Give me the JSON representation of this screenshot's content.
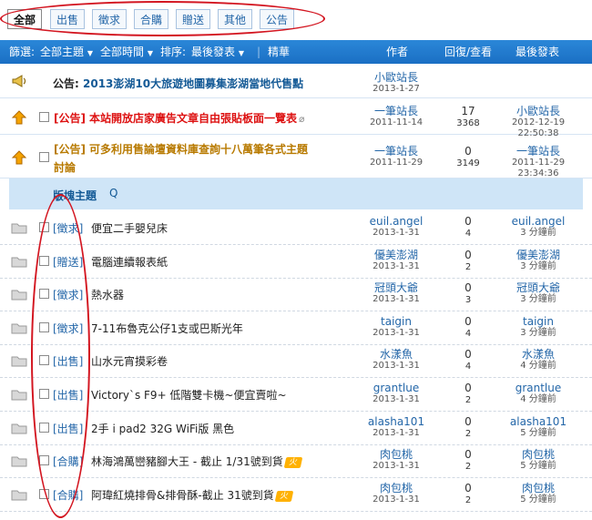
{
  "tabs": [
    "全部",
    "出售",
    "徵求",
    "合購",
    "贈送",
    "其他",
    "公告"
  ],
  "filterbar": {
    "filter_label": "篩選:",
    "all_topics": "全部主題",
    "all_time": "全部時間",
    "sort_label": "排序:",
    "sort_value": "最後發表",
    "divider": "|",
    "featured": "精華",
    "col_author": "作者",
    "col_replies": "回復/查看",
    "col_last": "最後發表"
  },
  "announcement": {
    "prefix": "公告:",
    "title": "2013澎湖10大旅遊地圖募集澎湖當地代售點",
    "author": "小歐站長",
    "date": "2013-1-27"
  },
  "sticky": [
    {
      "tag": "[公告]",
      "title_line1": "本站開放店家廣告文章自由張貼板面一覽表",
      "title_line2": "",
      "author": "一筆站長",
      "date": "2011-11-14",
      "replies": "17",
      "views": "3368",
      "last_author": "小歐站長",
      "last_time": "2012-12-19 22:50:38"
    },
    {
      "tag": "[公告]",
      "title_line1": "可多利用售論壇資料庫查詢十八萬筆各式主題",
      "title_line2": "討論",
      "author": "一筆站長",
      "date": "2011-11-29",
      "replies": "0",
      "views": "3149",
      "last_author": "一筆站長",
      "last_time": "2011-11-29 23:34:36"
    }
  ],
  "section": {
    "label": "版塊主題",
    "refresh_icon": "Q"
  },
  "threads": [
    {
      "tag": "[徵求]",
      "title": "便宜二手嬰兒床",
      "author": "euil.angel",
      "date": "2013-1-31",
      "replies": "0",
      "views": "4",
      "last_author": "euil.angel",
      "last_time": "3 分鐘前",
      "hot": ""
    },
    {
      "tag": "[贈送]",
      "title": "電腦連續報表紙",
      "author": "優美澎湖",
      "date": "2013-1-31",
      "replies": "0",
      "views": "2",
      "last_author": "優美澎湖",
      "last_time": "3 分鐘前",
      "hot": ""
    },
    {
      "tag": "[徵求]",
      "title": "熱水器",
      "author": "冠頭大爺",
      "date": "2013-1-31",
      "replies": "0",
      "views": "3",
      "last_author": "冠頭大爺",
      "last_time": "3 分鐘前",
      "hot": ""
    },
    {
      "tag": "[徵求]",
      "title": "7-11布魯克公仔1支或巴斯光年",
      "author": "taigin",
      "date": "2013-1-31",
      "replies": "0",
      "views": "4",
      "last_author": "taigin",
      "last_time": "3 分鐘前",
      "hot": ""
    },
    {
      "tag": "[出售]",
      "title": "山水元宵摸彩卷",
      "author": "水漾魚",
      "date": "2013-1-31",
      "replies": "0",
      "views": "4",
      "last_author": "水漾魚",
      "last_time": "4 分鐘前",
      "hot": ""
    },
    {
      "tag": "[出售]",
      "title": "Victory`s F9+ 低階雙卡機~便宜賣啦~",
      "author": "grantlue",
      "date": "2013-1-31",
      "replies": "0",
      "views": "2",
      "last_author": "grantlue",
      "last_time": "4 分鐘前",
      "hot": ""
    },
    {
      "tag": "[出售]",
      "title": "2手 i pad2 32G WiFi版 黑色",
      "author": "alasha101",
      "date": "2013-1-31",
      "replies": "0",
      "views": "2",
      "last_author": "alasha101",
      "last_time": "5 分鐘前",
      "hot": ""
    },
    {
      "tag": "[合購]",
      "title": "林海鴻萬巒豬腳大王 - 截止 1/31號到貨",
      "author": "肉包桃",
      "date": "2013-1-31",
      "replies": "0",
      "views": "2",
      "last_author": "肉包桃",
      "last_time": "5 分鐘前",
      "hot": "火"
    },
    {
      "tag": "[合購]",
      "title": "阿瑋紅燒排骨&排骨酥-截止 31號到貨",
      "author": "肉包桃",
      "date": "2013-1-31",
      "replies": "0",
      "views": "2",
      "last_author": "肉包桃",
      "last_time": "5 分鐘前",
      "hot": "火"
    }
  ],
  "colors": {
    "accent_bar": "#1a6fc4",
    "annotation_red": "#d31520",
    "section_bg": "#cfe5f7"
  }
}
